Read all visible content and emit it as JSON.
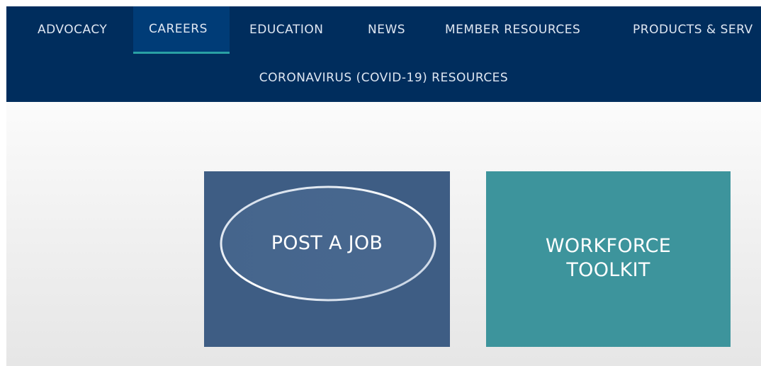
{
  "nav": {
    "items": [
      {
        "label": "ADVOCACY",
        "active": false
      },
      {
        "label": "CAREERS",
        "active": true
      },
      {
        "label": "EDUCATION",
        "active": false
      },
      {
        "label": "NEWS",
        "active": false
      },
      {
        "label": "MEMBER RESOURCES",
        "active": false
      },
      {
        "label": "PRODUCTS & SERV",
        "active": false
      }
    ],
    "row2_label": "CORONAVIRUS (COVID-19) RESOURCES"
  },
  "tiles": {
    "post_job": {
      "label": "POST A JOB"
    },
    "workforce_toolkit": {
      "label_line1": "WORKFORCE",
      "label_line2": "TOOLKIT"
    }
  },
  "colors": {
    "nav_bg": "#002d5d",
    "nav_active_bg": "#003c77",
    "nav_active_underline": "#2aa0a4",
    "tile_post_bg": "#3e5d84",
    "tile_workforce_bg": "#3d949c"
  }
}
